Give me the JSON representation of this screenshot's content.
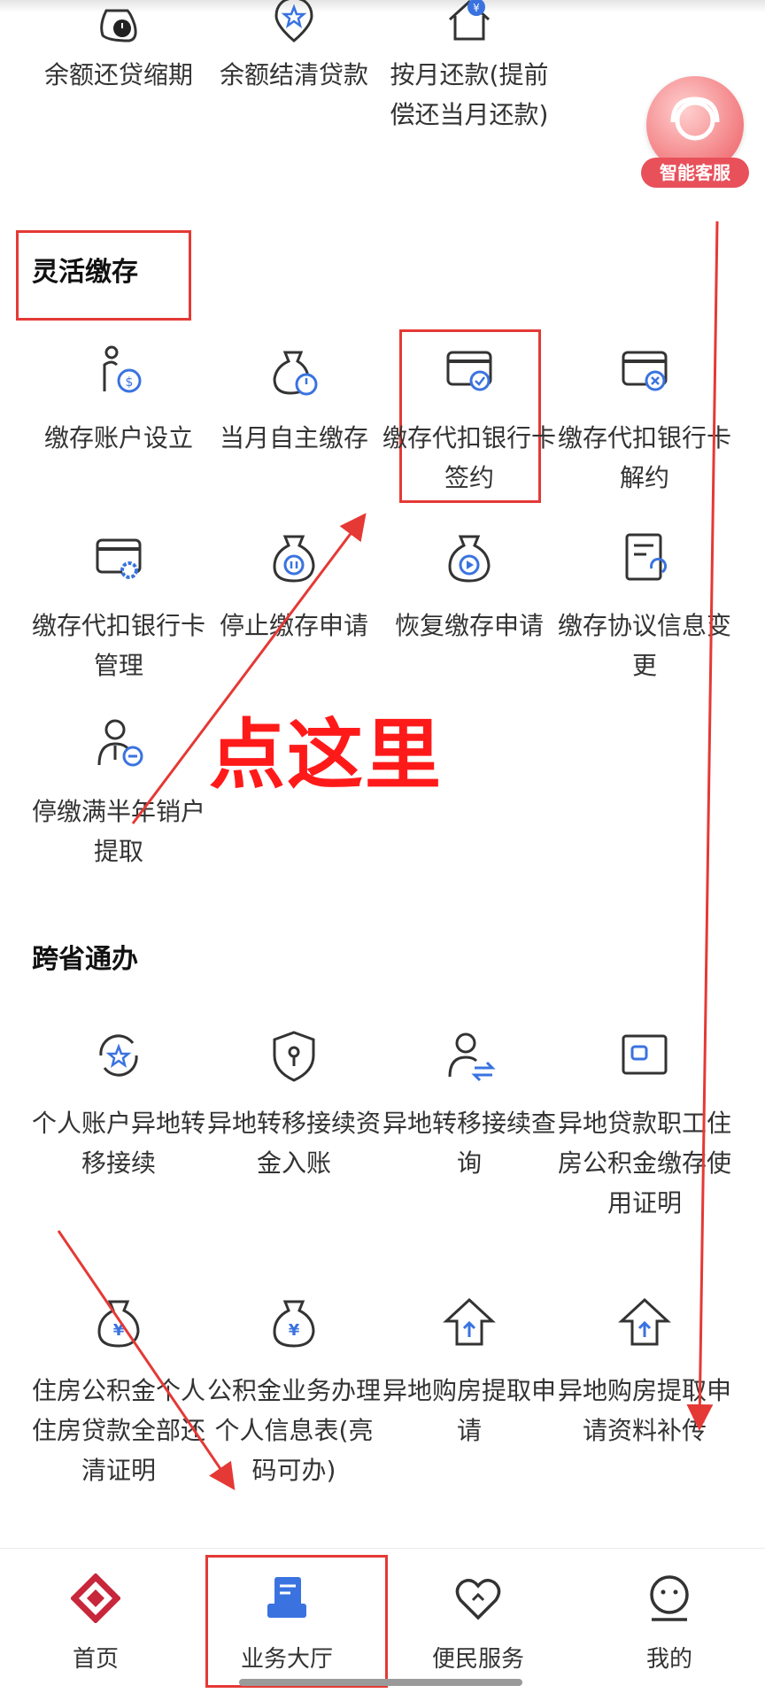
{
  "floating": {
    "customer_service_label": "智能客服"
  },
  "top_row": [
    {
      "label": "余额还贷缩期"
    },
    {
      "label": "余额结清贷款"
    },
    {
      "label": "按月还款(提前偿还当月还款)"
    }
  ],
  "section_flexible": {
    "title": "灵活缴存",
    "items": [
      {
        "label": "缴存账户设立"
      },
      {
        "label": "当月自主缴存"
      },
      {
        "label": "缴存代扣银行卡签约"
      },
      {
        "label": "缴存代扣银行卡解约"
      },
      {
        "label": "缴存代扣银行卡管理"
      },
      {
        "label": "停止缴存申请"
      },
      {
        "label": "恢复缴存申请"
      },
      {
        "label": "缴存协议信息变更"
      },
      {
        "label": "停缴满半年销户提取"
      }
    ]
  },
  "annotation": {
    "text": "点这里"
  },
  "section_cross": {
    "title": "跨省通办",
    "items": [
      {
        "label": "个人账户异地转移接续"
      },
      {
        "label": "异地转移接续资金入账"
      },
      {
        "label": "异地转移接续查询"
      },
      {
        "label": "异地贷款职工住房公积金缴存使用证明"
      },
      {
        "label": "住房公积金个人住房贷款全部还清证明"
      },
      {
        "label": "公积金业务办理个人信息表(亮码可办)"
      },
      {
        "label": "异地购房提取申请"
      },
      {
        "label": "异地购房提取申请资料补传"
      }
    ]
  },
  "tabbar": {
    "tabs": [
      {
        "label": "首页"
      },
      {
        "label": "业务大厅"
      },
      {
        "label": "便民服务"
      },
      {
        "label": "我的"
      }
    ]
  },
  "colors": {
    "accent": "#3a73e0",
    "icon_dark": "#333333",
    "annotation_red": "#e53935",
    "brand_red": "#c8263b"
  }
}
